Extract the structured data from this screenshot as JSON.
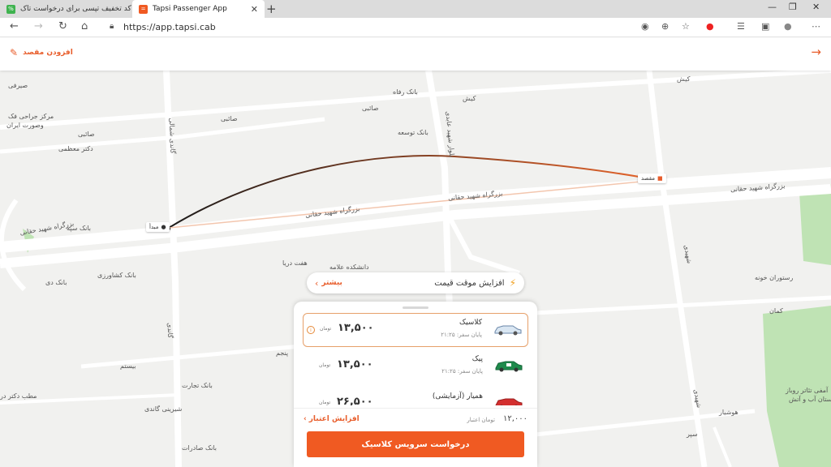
{
  "browser": {
    "tabs": [
      {
        "title": "کد تخفیف تپسی برای درخواست تاک..."
      },
      {
        "title": "Tapsi Passenger App"
      }
    ],
    "url": "https://app.tapsi.cab"
  },
  "header": {
    "add_destination": "افزودن مقصد"
  },
  "map": {
    "origin_label": "مبدأ",
    "destination_label": "مقصد",
    "labels": [
      "صیرفی",
      "مرکز جراحی فک",
      "وصورت ایران",
      "صائبی",
      "دکتر معظمی",
      "صائبی",
      "صائبی",
      "بانک رفاه",
      "بانک توسعه",
      "کیش",
      "کیش",
      "بزرگراه شهید حقانی",
      "بزرگراه شهید حقانی",
      "بزرگراه شهید حقانی",
      "بزرگراه شهید حقانی",
      "بانک سپه",
      "بانک کشاورزی",
      "بانک دی",
      "هفت دریا",
      "دانشکده علامه",
      "رستوران خونه",
      "کمان",
      "بیستم",
      "پنجم",
      "مطب دکتر در",
      "بانک تجارت",
      "شیرینی گاندی",
      "بانک صادرات",
      "هوشیار",
      "سپر",
      "آمفی تئاتر روباز",
      "بوستان آب و آتش",
      "شهیدی",
      "شهیدی",
      "بلوار شهید عابدی",
      "گاندی شمالی",
      "گاندی"
    ]
  },
  "surge": {
    "more": "بیشتر",
    "text": "افزایش موقت قیمت"
  },
  "rides": [
    {
      "name": "کلاسیک",
      "eta": "پایان سفر: ۲۱:۲۵",
      "price": "۱۳,۵۰۰",
      "unit": "تومان",
      "selected": true
    },
    {
      "name": "پیک",
      "eta": "پایان سفر: ۲۱:۲۵",
      "price": "۱۳,۵۰۰",
      "unit": "تومان",
      "selected": false
    },
    {
      "name": "همیار (آزمایشی)",
      "eta": "",
      "price": "۲۶,۵۰۰",
      "unit": "تومان",
      "selected": false
    }
  ],
  "credit": {
    "increase": "افزایش اعتبار",
    "value": "۱۲,۰۰۰",
    "label": "تومان اعتبار"
  },
  "request_button": "درخواست سرویس کلاسیک",
  "colors": {
    "accent": "#f05a22",
    "route_start": "#1a1a1a",
    "route_end": "#e8652b",
    "park": "#bfe3b4"
  }
}
